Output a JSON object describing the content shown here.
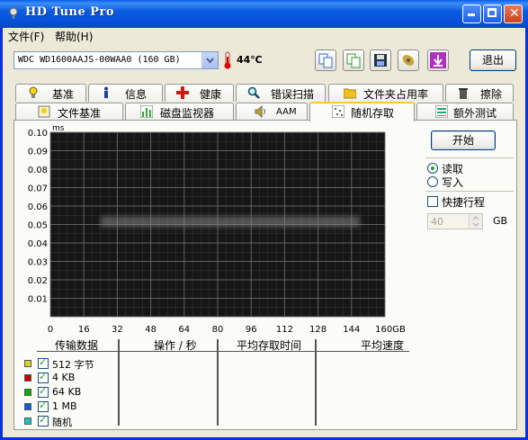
{
  "app": {
    "title": "HD Tune Pro"
  },
  "menu": {
    "file": "文件(F)",
    "help": "帮助(H)"
  },
  "toolbar": {
    "drive": "WDC WD1600AAJS-00WAA0 (160 GB)",
    "temperature": "44℃",
    "exit_label": "退出"
  },
  "tabs_top": [
    {
      "label": "基准"
    },
    {
      "label": "信息"
    },
    {
      "label": "健康"
    },
    {
      "label": "错误扫描"
    },
    {
      "label": "文件夹占用率"
    },
    {
      "label": "擦除"
    }
  ],
  "tabs_bottom": [
    {
      "label": "文件基准"
    },
    {
      "label": "磁盘监视器"
    },
    {
      "label": "AAM"
    },
    {
      "label": "随机存取"
    },
    {
      "label": "额外测试"
    }
  ],
  "controls": {
    "start_label": "开始",
    "read_label": "读取",
    "write_label": "写入",
    "quick_label": "快捷行程",
    "quick_value": "40",
    "quick_unit": "GB"
  },
  "chart_data": {
    "type": "scatter",
    "ylabel": "ms",
    "y_ticks": [
      "0.10",
      "0.09",
      "0.08",
      "0.07",
      "0.06",
      "0.05",
      "0.04",
      "0.03",
      "0.02",
      "0.01"
    ],
    "x_ticks": [
      "0",
      "16",
      "32",
      "48",
      "64",
      "80",
      "96",
      "112",
      "128",
      "144",
      "160GB"
    ],
    "xlim": [
      0,
      160
    ],
    "ylim": [
      0,
      0.1
    ],
    "band": {
      "x_start": 24,
      "x_end": 148,
      "y": 0.052
    },
    "colors": {
      "background": "#161616",
      "grid": "#6a6a6a",
      "band": "#3a3a3a"
    }
  },
  "results": {
    "headers": [
      "传输数据",
      "操作 / 秒",
      "平均存取时间",
      "平均速度"
    ],
    "rows": [
      {
        "label": "512 字节",
        "color": "#d8d800"
      },
      {
        "label": "4 KB",
        "color": "#c80000"
      },
      {
        "label": "64 KB",
        "color": "#00b000"
      },
      {
        "label": "1 MB",
        "color": "#1060d0"
      },
      {
        "label": "随机",
        "color": "#20c0c0"
      }
    ]
  }
}
